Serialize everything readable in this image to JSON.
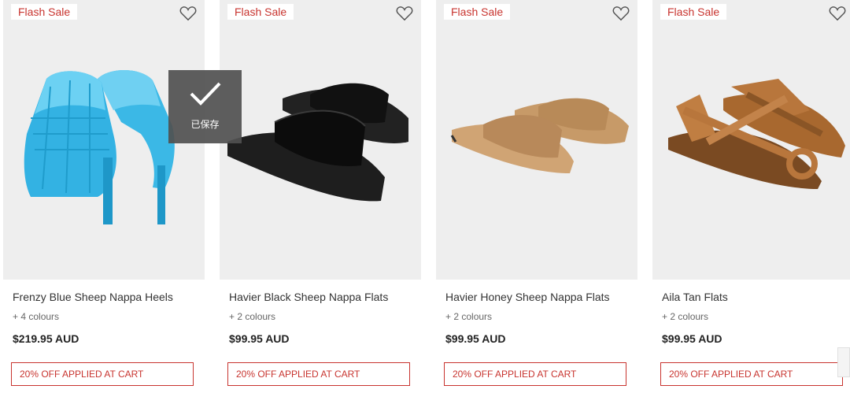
{
  "products": [
    {
      "badge": "Flash Sale",
      "name": "Frenzy Blue Sheep Nappa Heels",
      "colours": "+ 4 colours",
      "price": "$219.95 AUD",
      "promo": "20% OFF APPLIED AT CART",
      "shoe_color": "#3bb8e6",
      "shoe_dark": "#1e97c8"
    },
    {
      "badge": "Flash Sale",
      "name": "Havier Black Sheep Nappa Flats",
      "colours": "+ 2 colours",
      "price": "$99.95 AUD",
      "promo": "20% OFF APPLIED AT CART",
      "shoe_color": "#1a1a1a",
      "shoe_dark": "#000000"
    },
    {
      "badge": "Flash Sale",
      "name": "Havier Honey Sheep Nappa Flats",
      "colours": "+ 2 colours",
      "price": "$99.95 AUD",
      "promo": "20% OFF APPLIED AT CART",
      "shoe_color": "#c79a68",
      "shoe_dark": "#a87a4b"
    },
    {
      "badge": "Flash Sale",
      "name": "Aila Tan Flats",
      "colours": "+ 2 colours",
      "price": "$99.95 AUD",
      "promo": "20% OFF APPLIED AT CART",
      "shoe_color": "#b8763c",
      "shoe_dark": "#8a5526"
    }
  ],
  "saved_toast": {
    "label": "已保存"
  },
  "colors": {
    "accent": "#c8342f",
    "image_bg": "#eeeeee"
  }
}
